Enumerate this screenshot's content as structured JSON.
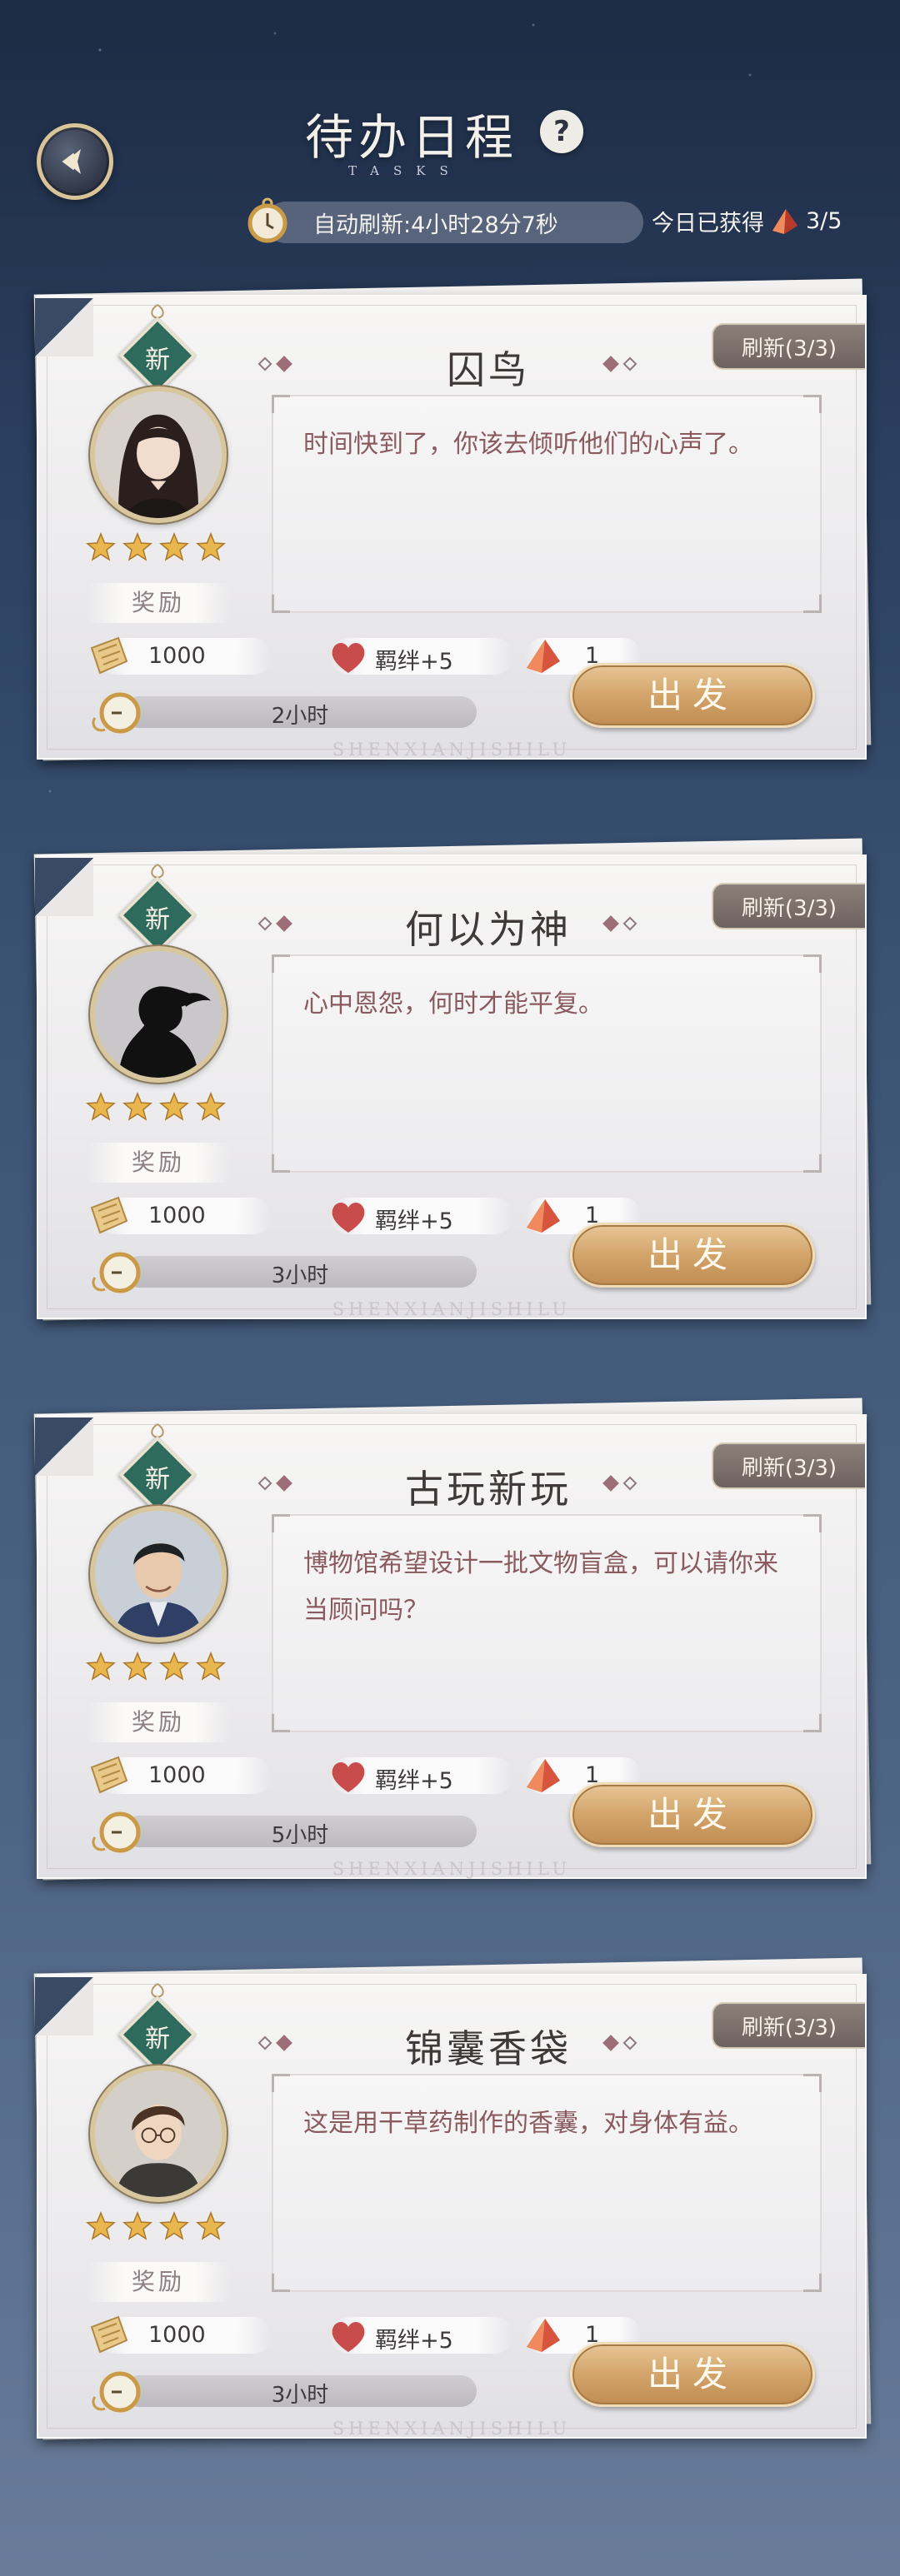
{
  "header": {
    "title": "待办日程",
    "subtitle": "TASKS",
    "help": "?",
    "auto_refresh": "自动刷新:4小时28分7秒",
    "daily_label": "今日已获得",
    "daily_count": "3/5"
  },
  "tasks": [
    {
      "new_tag": "新",
      "title": "囚鸟",
      "refresh": "刷新(3/3)",
      "stars": 4,
      "desc": "时间快到了，你该去倾听他们的心声了。",
      "reward_label": "奖励",
      "coins": "1000",
      "bond": "羁绊+5",
      "gems": "1",
      "duration": "2小时",
      "go": "出发",
      "watermark": "SHENXIANJISHILU"
    },
    {
      "new_tag": "新",
      "title": "何以为神",
      "refresh": "刷新(3/3)",
      "stars": 4,
      "desc": "心中恩怨，何时才能平复。",
      "reward_label": "奖励",
      "coins": "1000",
      "bond": "羁绊+5",
      "gems": "1",
      "duration": "3小时",
      "go": "出发",
      "watermark": "SHENXIANJISHILU"
    },
    {
      "new_tag": "新",
      "title": "古玩新玩",
      "refresh": "刷新(3/3)",
      "stars": 4,
      "desc": "博物馆希望设计一批文物盲盒，可以请你来当顾问吗？",
      "reward_label": "奖励",
      "coins": "1000",
      "bond": "羁绊+5",
      "gems": "1",
      "duration": "5小时",
      "go": "出发",
      "watermark": "SHENXIANJISHILU"
    },
    {
      "new_tag": "新",
      "title": "锦囊香袋",
      "refresh": "刷新(3/3)",
      "stars": 4,
      "desc": "这是用干草药制作的香囊，对身体有益。",
      "reward_label": "奖励",
      "coins": "1000",
      "bond": "羁绊+5",
      "gems": "1",
      "duration": "3小时",
      "go": "出发",
      "watermark": "SHENXIANJISHILU"
    }
  ],
  "colors": {
    "accent_gold": "#d3a46a",
    "tag_green": "#2f6a5e",
    "text_rose": "#8a5a5e"
  }
}
